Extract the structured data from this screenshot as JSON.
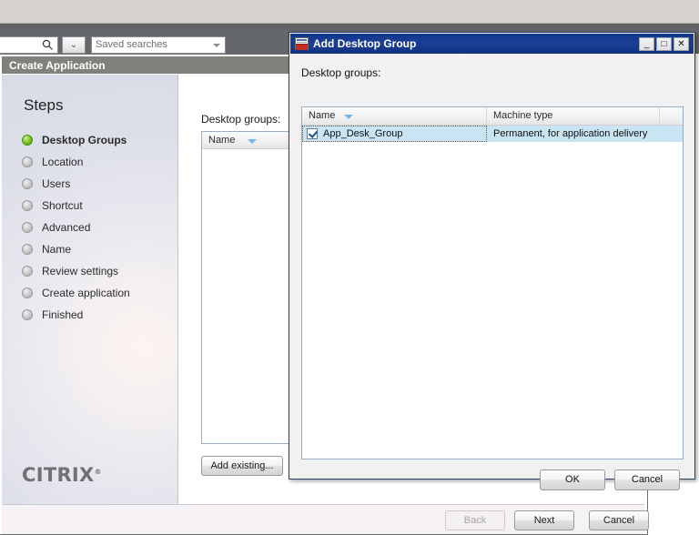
{
  "console": {
    "search_value": "",
    "search_icon": "search-icon",
    "dropdown_icon": "chevron-double-down-icon",
    "saved_searches_placeholder": "Saved searches"
  },
  "wizard": {
    "title": "Create Application",
    "steps_heading": "Steps",
    "steps": [
      {
        "label": "Desktop Groups",
        "state": "current"
      },
      {
        "label": "Location",
        "state": "pending"
      },
      {
        "label": "Users",
        "state": "pending"
      },
      {
        "label": "Shortcut",
        "state": "pending"
      },
      {
        "label": "Advanced",
        "state": "pending"
      },
      {
        "label": "Name",
        "state": "pending"
      },
      {
        "label": "Review settings",
        "state": "pending"
      },
      {
        "label": "Create application",
        "state": "pending"
      },
      {
        "label": "Finished",
        "state": "pending"
      }
    ],
    "brand": "CITRIX",
    "brand_tm": "®",
    "content": {
      "desktop_groups_label": "Desktop groups:",
      "list_column_name": "Name",
      "list_rows": [],
      "add_existing_label": "Add existing..."
    },
    "footer": {
      "back_label": "Back",
      "next_label": "Next",
      "cancel_label": "Cancel"
    }
  },
  "dialog": {
    "title": "Add Desktop Group",
    "icon": "desktop-group-icon",
    "controls": {
      "minimize": "_",
      "maximize": "□",
      "close": "✕"
    },
    "desktop_groups_label_pre": "Desktop ",
    "desktop_groups_label_underlined": "g",
    "desktop_groups_label_post": "roups:",
    "columns": [
      "Name",
      "Machine type",
      ""
    ],
    "rows": [
      {
        "checked": true,
        "name": "App_Desk_Group",
        "machine_type": "Permanent, for application delivery",
        "selected": true
      }
    ],
    "buttons": {
      "ok_label": "OK",
      "cancel_label": "Cancel"
    }
  },
  "colors": {
    "dialog_titlebar": "#16398d",
    "selection": "#c9e4f2",
    "wizard_titlebar": "#82807d",
    "step_active": "#7fc82a",
    "brand_gray": "#6f7175"
  }
}
